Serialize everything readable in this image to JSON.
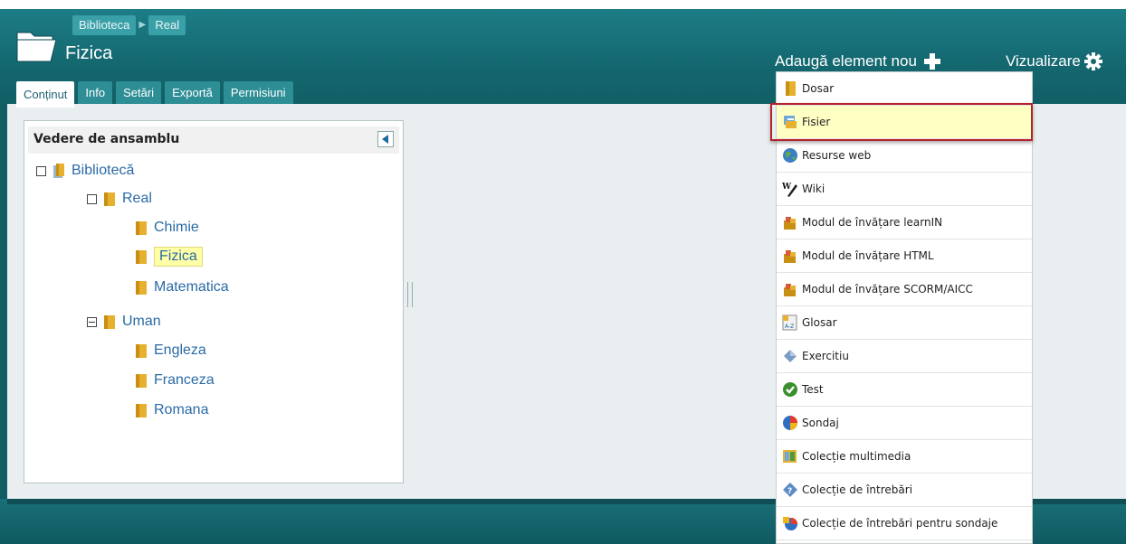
{
  "breadcrumb": [
    "Biblioteca",
    "Real"
  ],
  "page_title": "Fizica",
  "tabs": [
    {
      "label": "Conținut",
      "active": true
    },
    {
      "label": "Info",
      "active": false
    },
    {
      "label": "Setări",
      "active": false
    },
    {
      "label": "Exportă",
      "active": false
    },
    {
      "label": "Permisiuni",
      "active": false
    }
  ],
  "actions": {
    "add_label": "Adaugă element nou",
    "add_icon": "plus-icon",
    "view_label": "Vizualizare",
    "view_icon": "gear-icon"
  },
  "panel": {
    "title": "Vedere de ansamblu",
    "tree": [
      {
        "label": "Bibliotecă",
        "level": 0,
        "toggle": "box"
      },
      {
        "label": "Real",
        "level": 1,
        "toggle": "box"
      },
      {
        "label": "Chimie",
        "level": 2
      },
      {
        "label": "Fizica",
        "level": 2,
        "selected": true
      },
      {
        "label": "Matematica",
        "level": 2
      },
      {
        "label": "Uman",
        "level": 1,
        "toggle": "minus"
      },
      {
        "label": "Engleza",
        "level": 2
      },
      {
        "label": "Franceza",
        "level": 2
      },
      {
        "label": "Romana",
        "level": 2
      }
    ]
  },
  "menu": [
    {
      "label": "Dosar",
      "icon": "folder-icon"
    },
    {
      "label": "Fisier",
      "icon": "file-icon",
      "highlighted": true
    },
    {
      "label": "Resurse web",
      "icon": "globe-icon"
    },
    {
      "label": "Wiki",
      "icon": "wiki-icon"
    },
    {
      "label": "Modul de învățare learnIN",
      "icon": "module-icon"
    },
    {
      "label": "Modul de învățare HTML",
      "icon": "module-icon"
    },
    {
      "label": "Modul de învățare SCORM/AICC",
      "icon": "module-icon"
    },
    {
      "label": "Glosar",
      "icon": "glossary-icon"
    },
    {
      "label": "Exercitiu",
      "icon": "exercise-icon"
    },
    {
      "label": "Test",
      "icon": "test-icon"
    },
    {
      "label": "Sondaj",
      "icon": "poll-icon"
    },
    {
      "label": "Colecție multimedia",
      "icon": "multimedia-icon"
    },
    {
      "label": "Colecție de întrebări",
      "icon": "question-icon"
    },
    {
      "label": "Colecție de întrebări pentru sondaje",
      "icon": "poll-question-icon"
    }
  ],
  "colors": {
    "header": "#146870",
    "tab": "#2d8e96",
    "link": "#2a6aa6",
    "highlight": "#ffffc4",
    "highlight_border": "#b8202b"
  }
}
